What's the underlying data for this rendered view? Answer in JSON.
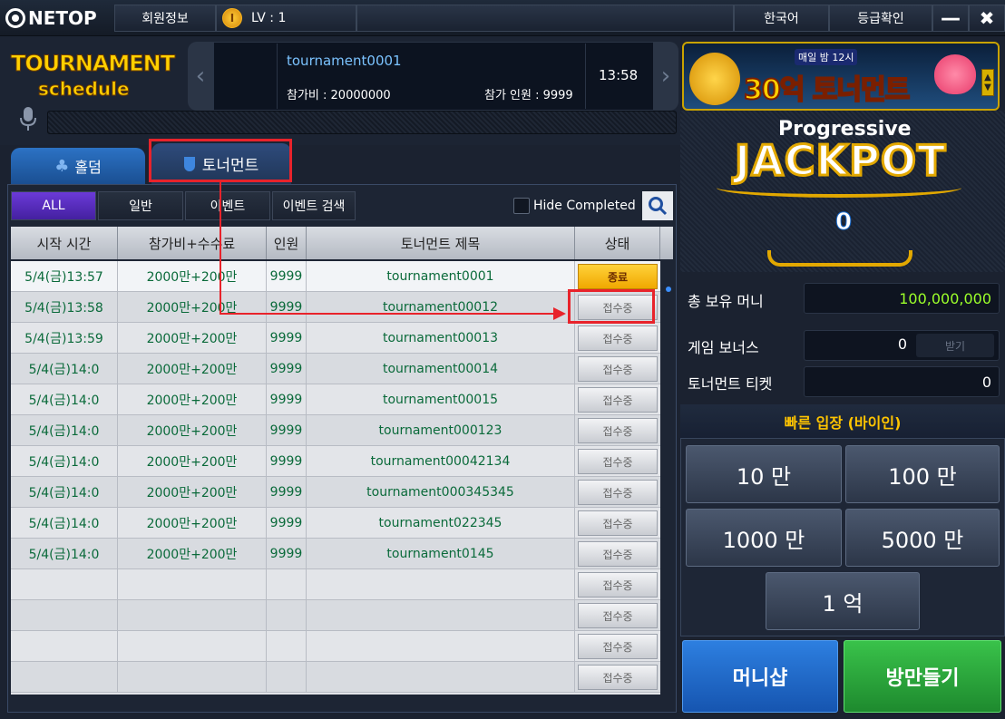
{
  "titlebar": {
    "logo": "NETOP",
    "member_info": "회원정보",
    "level_badge": "I",
    "level": "LV : 1",
    "language": "한국어",
    "grade_check": "등급확인",
    "minimize": "—",
    "close": "✖"
  },
  "header": {
    "title_line1": "TOURNAMENT",
    "title_line2": "schedule",
    "featured": {
      "name": "tournament0001",
      "fee": "참가비 : 20000000",
      "count": "참가 인원 : 9999",
      "time": "13:58"
    }
  },
  "tabs": {
    "holdem": "홀덤",
    "tournament": "토너먼트"
  },
  "filters": {
    "all": "ALL",
    "normal": "일반",
    "event": "이벤트",
    "event_search": "이벤트 검색",
    "hide_completed": "Hide Completed"
  },
  "table": {
    "columns": [
      "시작 시간",
      "참가비+수수료",
      "인원",
      "토너먼트 제목",
      "상태"
    ],
    "rows": [
      {
        "time": "5/4(금)13:57",
        "fee": "2000만+200만",
        "count": "9999",
        "title": "tournament0001",
        "status": "종료",
        "done": true
      },
      {
        "time": "5/4(금)13:58",
        "fee": "2000만+200만",
        "count": "9999",
        "title": "tournament00012",
        "status": "접수중"
      },
      {
        "time": "5/4(금)13:59",
        "fee": "2000만+200만",
        "count": "9999",
        "title": "tournament00013",
        "status": "접수중"
      },
      {
        "time": "5/4(금)14:0",
        "fee": "2000만+200만",
        "count": "9999",
        "title": "tournament00014",
        "status": "접수중"
      },
      {
        "time": "5/4(금)14:0",
        "fee": "2000만+200만",
        "count": "9999",
        "title": "tournament00015",
        "status": "접수중"
      },
      {
        "time": "5/4(금)14:0",
        "fee": "2000만+200만",
        "count": "9999",
        "title": "tournament000123",
        "status": "접수중"
      },
      {
        "time": "5/4(금)14:0",
        "fee": "2000만+200만",
        "count": "9999",
        "title": "tournament00042134",
        "status": "접수중"
      },
      {
        "time": "5/4(금)14:0",
        "fee": "2000만+200만",
        "count": "9999",
        "title": "tournament000345345",
        "status": "접수중"
      },
      {
        "time": "5/4(금)14:0",
        "fee": "2000만+200만",
        "count": "9999",
        "title": "tournament022345",
        "status": "접수중"
      },
      {
        "time": "5/4(금)14:0",
        "fee": "2000만+200만",
        "count": "9999",
        "title": "tournament0145",
        "status": "접수중"
      },
      {
        "time": "",
        "fee": "",
        "count": "",
        "title": "",
        "status": "접수중"
      },
      {
        "time": "",
        "fee": "",
        "count": "",
        "title": "",
        "status": "접수중"
      },
      {
        "time": "",
        "fee": "",
        "count": "",
        "title": "",
        "status": "접수중"
      },
      {
        "time": "",
        "fee": "",
        "count": "",
        "title": "",
        "status": "접수중"
      }
    ]
  },
  "banner": {
    "top_text": "매일 밤 12시",
    "main_text": "30억 토너먼트"
  },
  "jackpot": {
    "label_top": "Progressive",
    "label_main": "JACKPOT",
    "value": "0"
  },
  "money": {
    "total_label": "총 보유 머니",
    "total_value": "100,000,000",
    "bonus_label": "게임 보너스",
    "bonus_value": "0",
    "bonus_claim": "받기",
    "ticket_label": "토너먼트 티켓",
    "ticket_value": "0"
  },
  "quick_entry": {
    "title": "빠른 입장 (바이인)",
    "buttons": [
      "10 만",
      "100 만",
      "1000 만",
      "5000 만",
      "1 억"
    ]
  },
  "actions": {
    "money_shop": "머니샵",
    "make_room": "방만들기"
  },
  "colors": {
    "annotation": "#e8232b",
    "accent_green": "#9cff2a",
    "title_gold": "#ffd000"
  }
}
